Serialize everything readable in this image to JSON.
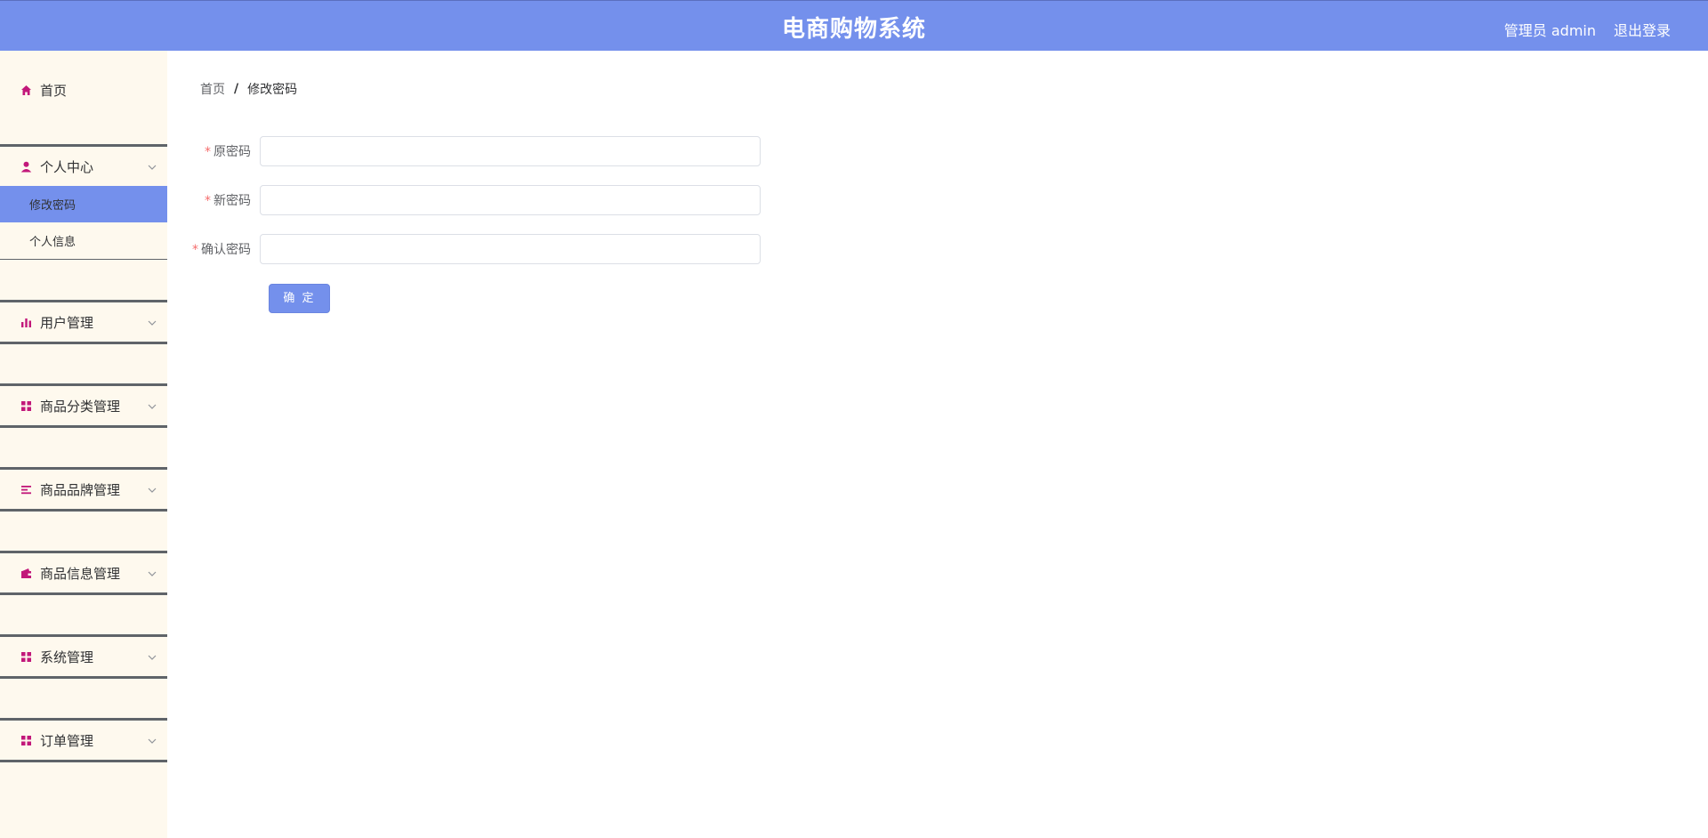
{
  "header": {
    "title": "电商购物系统",
    "user": "管理员 admin",
    "logout": "退出登录"
  },
  "sidebar": {
    "home": {
      "label": "首页",
      "icon": "home-icon"
    },
    "groups": [
      {
        "label": "个人中心",
        "icon": "user-icon",
        "open": true,
        "items": [
          {
            "label": "修改密码",
            "active": true
          },
          {
            "label": "个人信息",
            "active": false
          }
        ]
      },
      {
        "label": "用户管理",
        "icon": "bar-chart-icon"
      },
      {
        "label": "商品分类管理",
        "icon": "grid-icon"
      },
      {
        "label": "商品品牌管理",
        "icon": "list-icon"
      },
      {
        "label": "商品信息管理",
        "icon": "wallet-icon"
      },
      {
        "label": "系统管理",
        "icon": "grid-icon"
      },
      {
        "label": "订单管理",
        "icon": "grid-icon"
      }
    ]
  },
  "breadcrumb": {
    "home": "首页",
    "separator": "/",
    "current": "修改密码"
  },
  "form": {
    "required_mark": "*",
    "old_password": {
      "label": "原密码",
      "value": ""
    },
    "new_password": {
      "label": "新密码",
      "value": ""
    },
    "confirm_password": {
      "label": "确认密码",
      "value": ""
    },
    "submit": "确 定"
  },
  "colors": {
    "primary": "#7490ec",
    "sidebar_bg": "#fef9ee",
    "icon": "#c2187a",
    "required": "#f56c6c",
    "divider": "#5f6469"
  }
}
